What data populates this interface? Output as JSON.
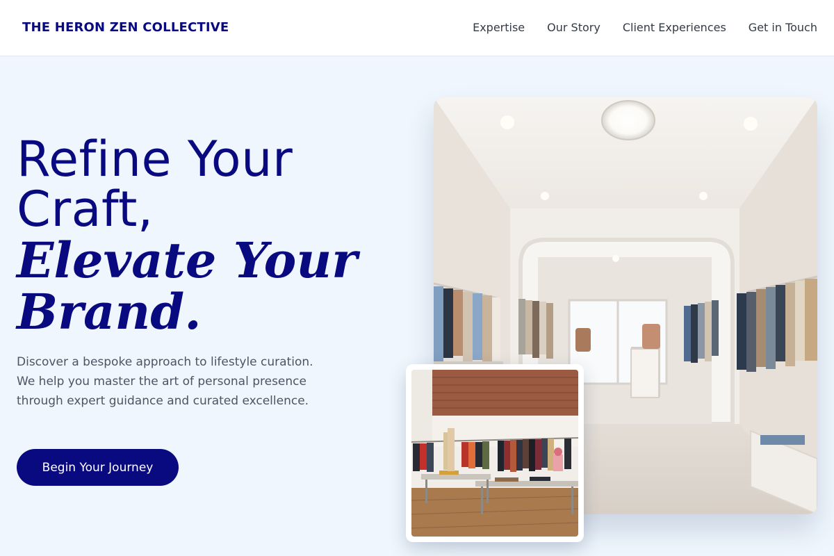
{
  "header": {
    "brand": "THE HERON ZEN COLLECTIVE",
    "nav": [
      {
        "label": "Expertise"
      },
      {
        "label": "Our Story"
      },
      {
        "label": "Client Experiences"
      },
      {
        "label": "Get in Touch"
      }
    ]
  },
  "hero": {
    "title_line1": "Refine Your",
    "title_line2": "Craft,",
    "title_line3": "Elevate Your",
    "title_line4": "Brand.",
    "description": "Discover a bespoke approach to lifestyle curation. We help you master the art of personal presence through expert guidance and curated excellence.",
    "cta_label": "Begin Your Journey"
  },
  "colors": {
    "accent": "#0a0a80",
    "background": "#eff6fd",
    "body_text": "#4b5563"
  }
}
